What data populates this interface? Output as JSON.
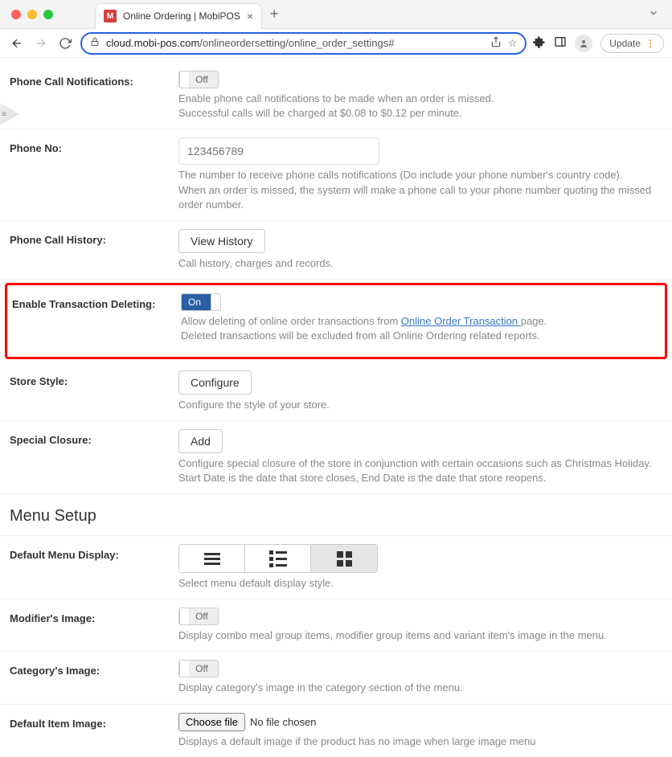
{
  "browser": {
    "tab_title": "Online Ordering | MobiPOS",
    "url_host": "cloud.mobi-pos.com",
    "url_path": "/onlineordersetting/online_order_settings#",
    "update_label": "Update"
  },
  "rows": {
    "phone_notif": {
      "label": "Phone Call Notifications:",
      "toggle": "Off",
      "help1": "Enable phone call notifications to be made when an order is missed.",
      "help2": "Successful calls will be charged at $0.08 to $0.12 per minute."
    },
    "phone_no": {
      "label": "Phone No:",
      "placeholder": "123456789",
      "help1": "The number to receive phone calls notifications (Do include your phone number's country code).",
      "help2": "When an order is missed, the system will make a phone call to your phone number quoting the missed order number."
    },
    "history": {
      "label": "Phone Call History:",
      "button": "View History",
      "help": "Call history, charges and records."
    },
    "txdel": {
      "label": "Enable Transaction Deleting:",
      "toggle": "On",
      "help1a": "Allow deleting of online order transactions from ",
      "help1_link": "Online Order Transaction ",
      "help1b": "page.",
      "help2": "Deleted transactions will be excluded from all Online Ordering related reports."
    },
    "style": {
      "label": "Store Style:",
      "button": "Configure",
      "help": "Configure the style of your store."
    },
    "closure": {
      "label": "Special Closure:",
      "button": "Add",
      "help1": "Configure special closure of the store in conjunction with certain occasions such as Christmas Holiday.",
      "help2": "Start Date is the date that store closes, End Date is the date that store reopens."
    }
  },
  "section": {
    "title": "Menu Setup"
  },
  "menu": {
    "display": {
      "label": "Default Menu Display:",
      "help": "Select menu default display style."
    },
    "mod_img": {
      "label": "Modifier's Image:",
      "toggle": "Off",
      "help": "Display combo meal group items, modifier group items and variant item's image in the menu."
    },
    "cat_img": {
      "label": "Category's Image:",
      "toggle": "Off",
      "help": "Display category's image in the category section of the menu."
    },
    "def_img": {
      "label": "Default Item Image:",
      "file_button": "Choose file",
      "file_text": "No file chosen",
      "help": "Displays a default image if the product has no image when large image menu"
    }
  }
}
